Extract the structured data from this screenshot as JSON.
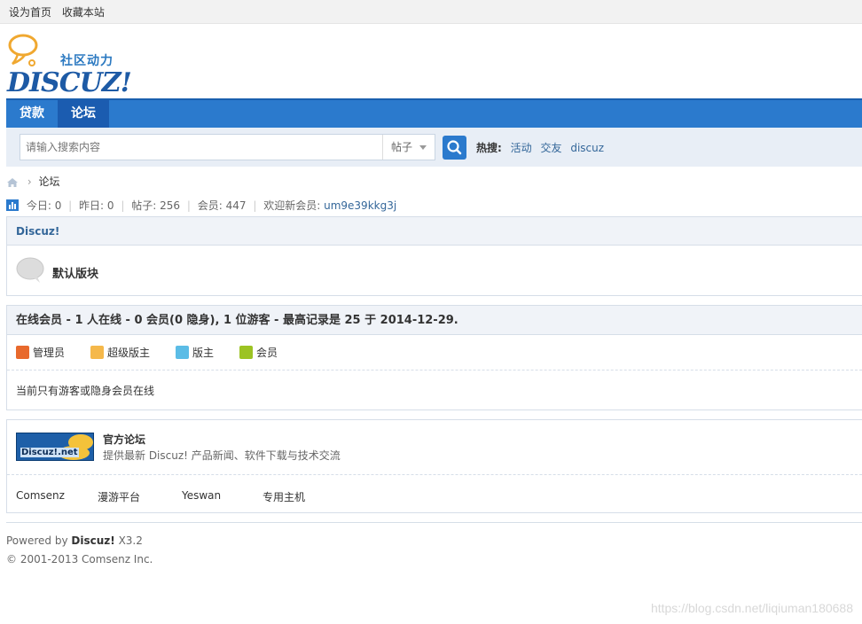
{
  "topbar": {
    "set_home": "设为首页",
    "bookmark": "收藏本站"
  },
  "logo": {
    "subtitle": "社区动力",
    "brand": "DISCUZ!"
  },
  "nav": [
    {
      "label": "贷款"
    },
    {
      "label": "论坛"
    }
  ],
  "search": {
    "placeholder": "请输入搜索内容",
    "type": "帖子",
    "hot_label": "热搜:",
    "hot": [
      "活动",
      "交友",
      "discuz"
    ]
  },
  "breadcrumb": {
    "current": "论坛"
  },
  "stats": {
    "today_label": "今日:",
    "today": "0",
    "yesterday_label": "昨日:",
    "yesterday": "0",
    "posts_label": "帖子:",
    "posts": "256",
    "members_label": "会员:",
    "members": "447",
    "newest_label": "欢迎新会员:",
    "newest": "um9e39kkg3j"
  },
  "category": {
    "title": "Discuz!",
    "forum": "默认版块"
  },
  "online": {
    "title": "在线会员 - 1 人在线 - 0 会员(0 隐身), 1 位游客 - 最高记录是 25 于 2014-12-29.",
    "legend": [
      {
        "label": "管理员",
        "color": "#e8692c"
      },
      {
        "label": "超级版主",
        "color": "#f5b84a"
      },
      {
        "label": "版主",
        "color": "#5bbce6"
      },
      {
        "label": "会员",
        "color": "#9cc323"
      }
    ],
    "note": "当前只有游客或隐身会员在线"
  },
  "links": {
    "logo_text": "Discuz!.net",
    "title": "官方论坛",
    "desc": "提供最新 Discuz! 产品新闻、软件下载与技术交流",
    "items": [
      "Comsenz",
      "漫游平台",
      "Yeswan",
      "专用主机"
    ]
  },
  "footer": {
    "powered": "Powered by",
    "product": "Discuz!",
    "version": "X3.2",
    "copyright": "© 2001-2013 Comsenz Inc."
  },
  "watermark": "https://blog.csdn.net/liqiuman180688"
}
